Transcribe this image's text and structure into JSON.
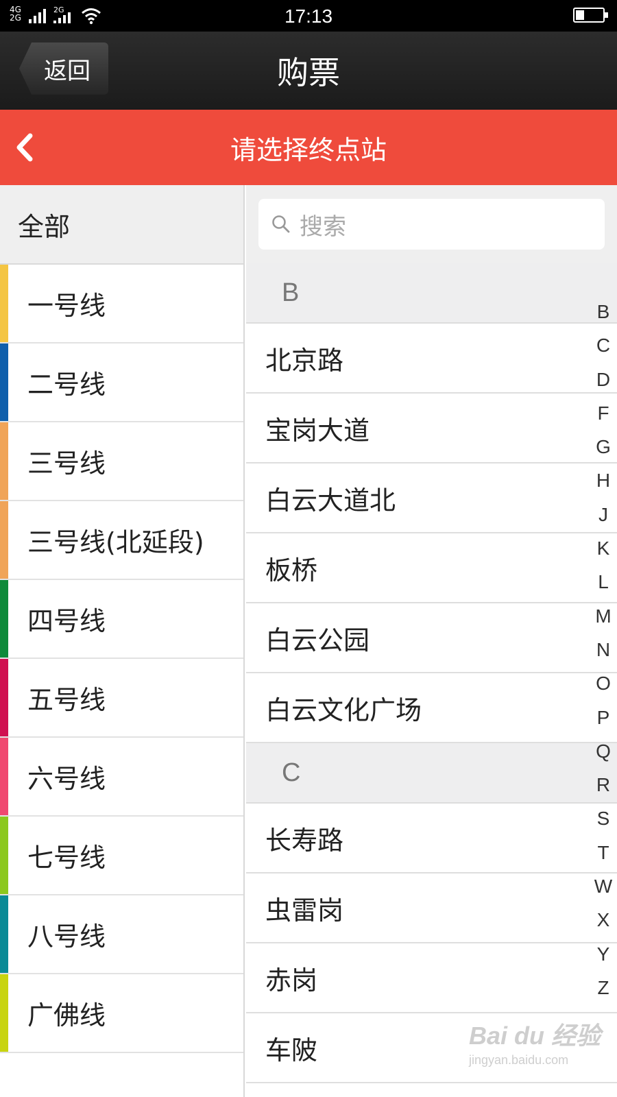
{
  "status_bar": {
    "network1": "4G",
    "network2": "2G",
    "network3": "2G",
    "time": "17:13",
    "icons": [
      "signal-icon",
      "wifi-icon",
      "battery-icon"
    ]
  },
  "titlebar": {
    "back_label": "返回",
    "title": "购票"
  },
  "header": {
    "title": "请选择终点站",
    "back_icon": "chevron-left-icon",
    "color": "#ef4b3c"
  },
  "lines": {
    "all_label": "全部",
    "items": [
      {
        "label": "一号线",
        "color": "#f4c542"
      },
      {
        "label": "二号线",
        "color": "#0f5fac"
      },
      {
        "label": "三号线",
        "color": "#f0a458"
      },
      {
        "label": "三号线(北延段)",
        "color": "#f0a458"
      },
      {
        "label": "四号线",
        "color": "#0e8a3a"
      },
      {
        "label": "五号线",
        "color": "#d01050"
      },
      {
        "label": "六号线",
        "color": "#f04870"
      },
      {
        "label": "七号线",
        "color": "#8cc81e"
      },
      {
        "label": "八号线",
        "color": "#0a8a96"
      },
      {
        "label": "广佛线",
        "color": "#c8d410"
      }
    ]
  },
  "search": {
    "placeholder": "搜索",
    "icon": "search-icon"
  },
  "stations": {
    "sections": [
      {
        "letter": "B",
        "items": [
          "北京路",
          "宝岗大道",
          "白云大道北",
          "板桥",
          "白云公园",
          "白云文化广场"
        ]
      },
      {
        "letter": "C",
        "items": [
          "长寿路",
          "虫雷岗",
          "赤岗",
          "车陂"
        ]
      }
    ]
  },
  "index_letters": [
    "B",
    "C",
    "D",
    "F",
    "G",
    "H",
    "J",
    "K",
    "L",
    "M",
    "N",
    "O",
    "P",
    "Q",
    "R",
    "S",
    "T",
    "W",
    "X",
    "Y",
    "Z"
  ],
  "watermark": {
    "line1": "Bai du 经验",
    "line2": "jingyan.baidu.com"
  }
}
